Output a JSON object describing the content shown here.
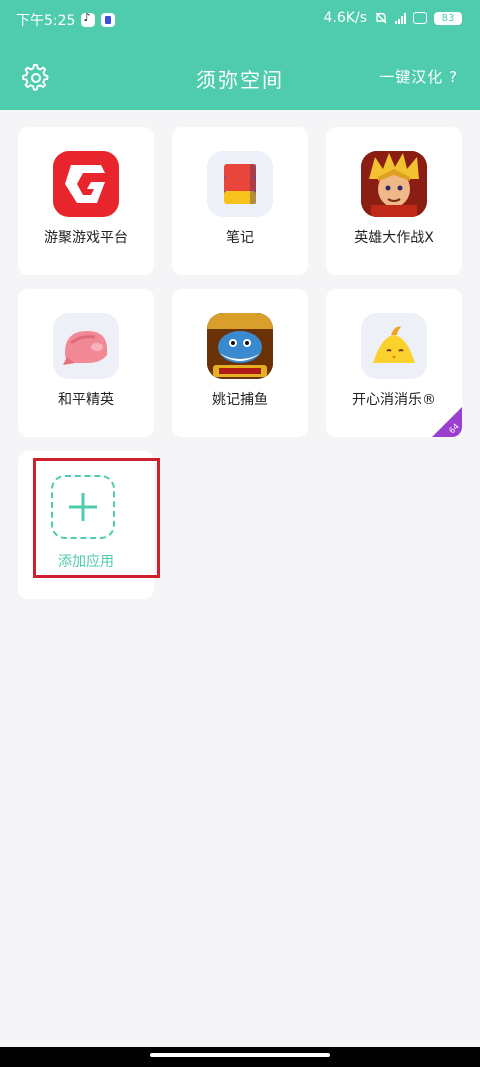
{
  "status_bar": {
    "time": "下午5:25",
    "network_speed": "4.6K/s",
    "battery": "83"
  },
  "header": {
    "title": "须弥空间",
    "translate_label": "一键汉化 ?"
  },
  "apps": [
    {
      "label": "游聚游戏平台",
      "icon": "youju-g-icon"
    },
    {
      "label": "笔记",
      "icon": "notebook-icon"
    },
    {
      "label": "英雄大作战X",
      "icon": "hero-avatar-icon"
    },
    {
      "label": "和平精英",
      "icon": "pink-helmet-icon"
    },
    {
      "label": "姚记捕鱼",
      "icon": "fish-game-icon"
    },
    {
      "label": "开心消消乐®",
      "icon": "yellow-chick-icon"
    }
  ],
  "app_badges": {
    "happy_elimination": "64"
  },
  "add_app": {
    "label": "添加应用"
  },
  "colors": {
    "accent": "#4fcbad",
    "highlight_border": "#d0202e"
  }
}
